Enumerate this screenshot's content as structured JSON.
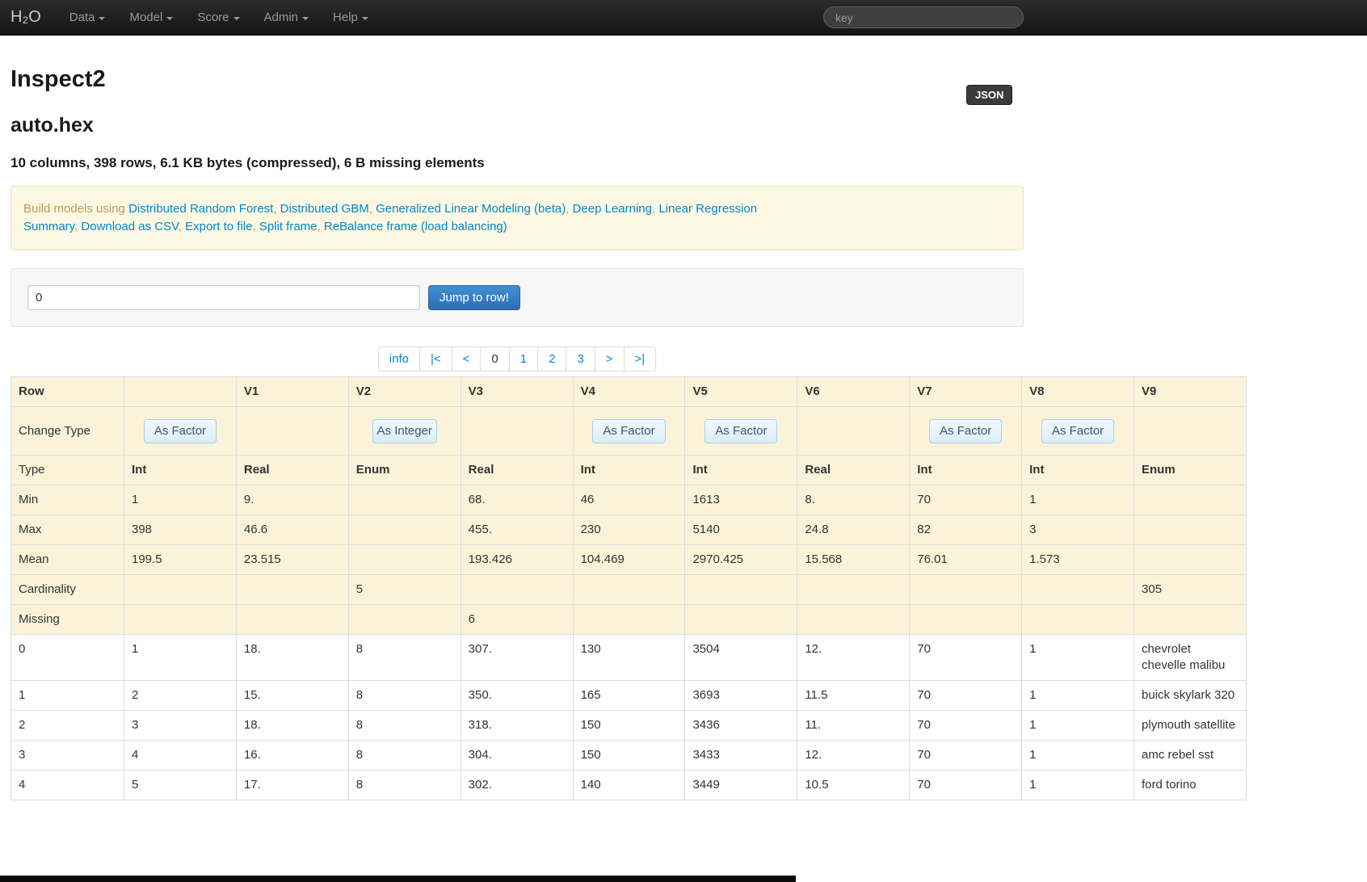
{
  "navbar": {
    "brand": "H₂O",
    "items": [
      {
        "label": "Data"
      },
      {
        "label": "Model"
      },
      {
        "label": "Score"
      },
      {
        "label": "Admin"
      },
      {
        "label": "Help"
      }
    ],
    "search_placeholder": "key"
  },
  "header": {
    "json_button": "JSON",
    "page_title": "Inspect2",
    "frame_name": "auto.hex",
    "summary": "10 columns, 398 rows, 6.1 KB bytes (compressed), 6 B missing elements"
  },
  "build_box": {
    "prefix": "Build models using ",
    "model_links": [
      "Distributed Random Forest",
      "Distributed GBM",
      "Generalized Linear Modeling (beta)",
      "Deep Learning",
      "Linear Regression"
    ],
    "action_links": [
      "Summary",
      "Download as CSV",
      "Export to file",
      "Split frame",
      "ReBalance frame (load balancing)"
    ]
  },
  "jump": {
    "input_value": "0",
    "button_label": "Jump to row!"
  },
  "pagination": {
    "items": [
      {
        "label": "info",
        "name": "info"
      },
      {
        "label": "|<",
        "name": "first-page"
      },
      {
        "label": "<",
        "name": "prev-page"
      },
      {
        "label": "0",
        "name": "page-0",
        "current": true
      },
      {
        "label": "1",
        "name": "page-1"
      },
      {
        "label": "2",
        "name": "page-2"
      },
      {
        "label": "3",
        "name": "page-3"
      },
      {
        "label": ">",
        "name": "next-page"
      },
      {
        "label": ">|",
        "name": "last-page"
      }
    ]
  },
  "table": {
    "columns": [
      "Row",
      "",
      "V1",
      "V2",
      "V3",
      "V4",
      "V5",
      "V6",
      "V7",
      "V8",
      "V9"
    ],
    "change_type": {
      "label": "Change Type",
      "buttons": [
        "As Factor",
        "",
        "As Integer",
        "",
        "As Factor",
        "As Factor",
        "",
        "As Factor",
        "As Factor",
        ""
      ]
    },
    "stat_rows": [
      {
        "label": "Type",
        "values": [
          "Int",
          "Real",
          "Enum",
          "Real",
          "Int",
          "Int",
          "Real",
          "Int",
          "Int",
          "Enum"
        ]
      },
      {
        "label": "Min",
        "values": [
          "1",
          "9.",
          "",
          "68.",
          "46",
          "1613",
          "8.",
          "70",
          "1",
          ""
        ]
      },
      {
        "label": "Max",
        "values": [
          "398",
          "46.6",
          "",
          "455.",
          "230",
          "5140",
          "24.8",
          "82",
          "3",
          ""
        ]
      },
      {
        "label": "Mean",
        "values": [
          "199.5",
          "23.515",
          "",
          "193.426",
          "104.469",
          "2970.425",
          "15.568",
          "76.01",
          "1.573",
          ""
        ]
      },
      {
        "label": "Cardinality",
        "values": [
          "",
          "",
          "5",
          "",
          "",
          "",
          "",
          "",
          "",
          "305"
        ]
      },
      {
        "label": "Missing",
        "values": [
          "",
          "",
          "",
          "6",
          "",
          "",
          "",
          "",
          "",
          ""
        ]
      }
    ],
    "data_rows": [
      {
        "row": "0",
        "values": [
          "1",
          "18.",
          "8",
          "307.",
          "130",
          "3504",
          "12.",
          "70",
          "1",
          "chevrolet chevelle malibu"
        ]
      },
      {
        "row": "1",
        "values": [
          "2",
          "15.",
          "8",
          "350.",
          "165",
          "3693",
          "11.5",
          "70",
          "1",
          "buick skylark 320"
        ]
      },
      {
        "row": "2",
        "values": [
          "3",
          "18.",
          "8",
          "318.",
          "150",
          "3436",
          "11.",
          "70",
          "1",
          "plymouth satellite"
        ]
      },
      {
        "row": "3",
        "values": [
          "4",
          "16.",
          "8",
          "304.",
          "150",
          "3433",
          "12.",
          "70",
          "1",
          "amc rebel sst"
        ]
      },
      {
        "row": "4",
        "values": [
          "5",
          "17.",
          "8",
          "302.",
          "140",
          "3449",
          "10.5",
          "70",
          "1",
          "ford torino"
        ]
      }
    ]
  },
  "colors": {
    "link": "#0088cc",
    "alert_text": "#c09853",
    "alert_background": "#fcf8e3",
    "table_stat_background": "#faf3da",
    "primary_button": "#3a7ec2",
    "navbar_background": "#1d1d1d"
  }
}
